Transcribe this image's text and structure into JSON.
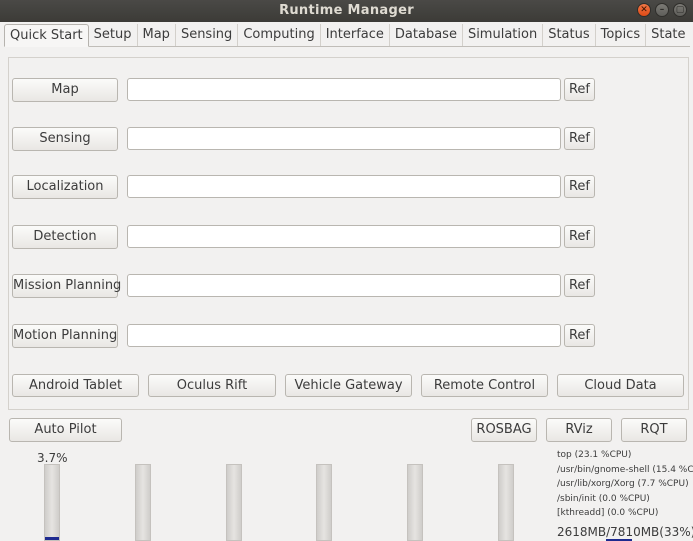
{
  "window": {
    "title": "Runtime Manager",
    "close_glyph": "✕",
    "minimize_glyph": "–",
    "maximize_glyph": "▢"
  },
  "tabs": [
    {
      "label": "Quick Start",
      "active": true
    },
    {
      "label": "Setup"
    },
    {
      "label": "Map"
    },
    {
      "label": "Sensing"
    },
    {
      "label": "Computing"
    },
    {
      "label": "Interface"
    },
    {
      "label": "Database"
    },
    {
      "label": "Simulation"
    },
    {
      "label": "Status"
    },
    {
      "label": "Topics"
    },
    {
      "label": "State"
    }
  ],
  "quick_start": {
    "rows": [
      {
        "label": "Map",
        "value": "",
        "ref": "Ref"
      },
      {
        "label": "Sensing",
        "value": "",
        "ref": "Ref"
      },
      {
        "label": "Localization",
        "value": "",
        "ref": "Ref"
      },
      {
        "label": "Detection",
        "value": "",
        "ref": "Ref"
      },
      {
        "label": "Mission Planning",
        "value": "",
        "ref": "Ref"
      },
      {
        "label": "Motion Planning",
        "value": "",
        "ref": "Ref"
      }
    ],
    "extras": [
      "Android Tablet",
      "Oculus Rift",
      "Vehicle Gateway",
      "Remote Control",
      "Cloud Data"
    ]
  },
  "bottom_buttons": {
    "auto_pilot": "Auto Pilot",
    "rosbag": "ROSBAG",
    "rviz": "RViz",
    "rqt": "RQT"
  },
  "status": {
    "cpu_percent_label": "3.7%",
    "cpu_bars": [
      0.037,
      0,
      0,
      0,
      0,
      0
    ],
    "processes": [
      "top (23.1 %CPU)",
      "/usr/bin/gnome-shell (15.4 %CPU)",
      "/usr/lib/xorg/Xorg (7.7 %CPU)",
      "/sbin/init (0.0 %CPU)",
      "[kthreadd] (0.0 %CPU)"
    ],
    "memory": "2618MB/7810MB(33%)",
    "memory_fraction": 0.33
  },
  "colors": {
    "accent": "#1e2a8f",
    "titlebar": "#3c3b37",
    "close_button": "#df4a16"
  }
}
